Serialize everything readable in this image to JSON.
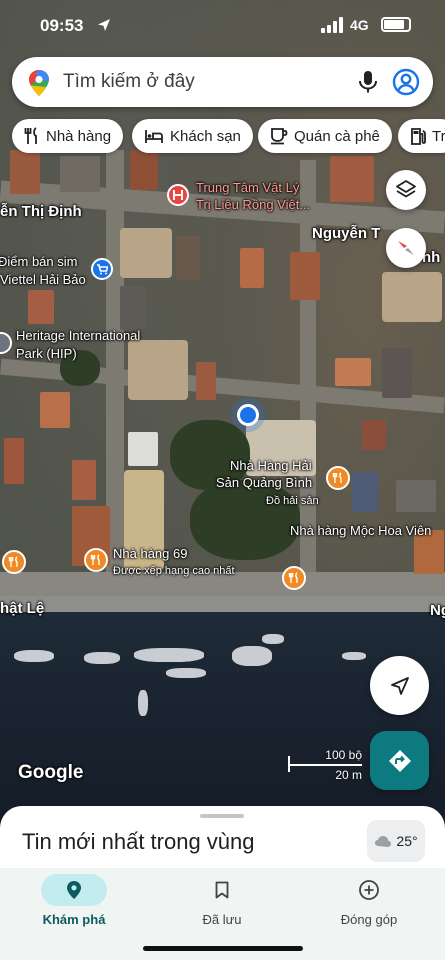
{
  "status_bar": {
    "time": "09:53",
    "network": "4G",
    "battery_level": 0.85
  },
  "search": {
    "placeholder": "Tìm kiếm ở đây",
    "icons": [
      "google-maps-logo-icon",
      "mic-icon",
      "account-icon"
    ]
  },
  "chips": [
    {
      "label": "Nhà hàng",
      "icon": "fork-knife-icon"
    },
    {
      "label": "Khách sạn",
      "icon": "bed-icon"
    },
    {
      "label": "Quán cà phê",
      "icon": "coffee-cup-icon"
    },
    {
      "label": "Tr",
      "icon": "gas-pump-icon"
    }
  ],
  "map": {
    "road_labels": [
      "ễn Thị Định",
      "Nguyễn T",
      "nh",
      "hật Lệ",
      "Ng"
    ],
    "places": [
      {
        "name_line1": "Trung Tâm Vật Lý",
        "name_line2": "Trị Liệu Rồng Việt...",
        "type": "hospital"
      },
      {
        "name_line1": "Điểm bán sim",
        "name_line2": "Viettel Hải Bảo",
        "type": "shop"
      },
      {
        "name_line1": "Heritage International",
        "name_line2": "Park (HIP)",
        "type": "park"
      },
      {
        "name_line1": "Nhà Hàng Hải",
        "name_line2": "Sản Quảng Bình",
        "sub": "Đồ hải sản",
        "type": "restaurant"
      },
      {
        "name_line1": "Nhà hàng Mộc Hoa Viên",
        "type": "restaurant"
      },
      {
        "name_line1": "Nhà hàng 69",
        "sub": "Được xếp hạng cao nhất",
        "type": "restaurant"
      }
    ],
    "attribution": "Google",
    "scale": {
      "imperial": "100 bộ",
      "metric": "20 m"
    }
  },
  "sheet": {
    "title": "Tin mới nhất trong vùng",
    "weather": "25°"
  },
  "nav": [
    {
      "label": "Khám phá",
      "icon": "explore-pin-icon",
      "active": true
    },
    {
      "label": "Đã lưu",
      "icon": "bookmark-icon",
      "active": false
    },
    {
      "label": "Đóng góp",
      "icon": "add-circle-icon",
      "active": false
    }
  ]
}
